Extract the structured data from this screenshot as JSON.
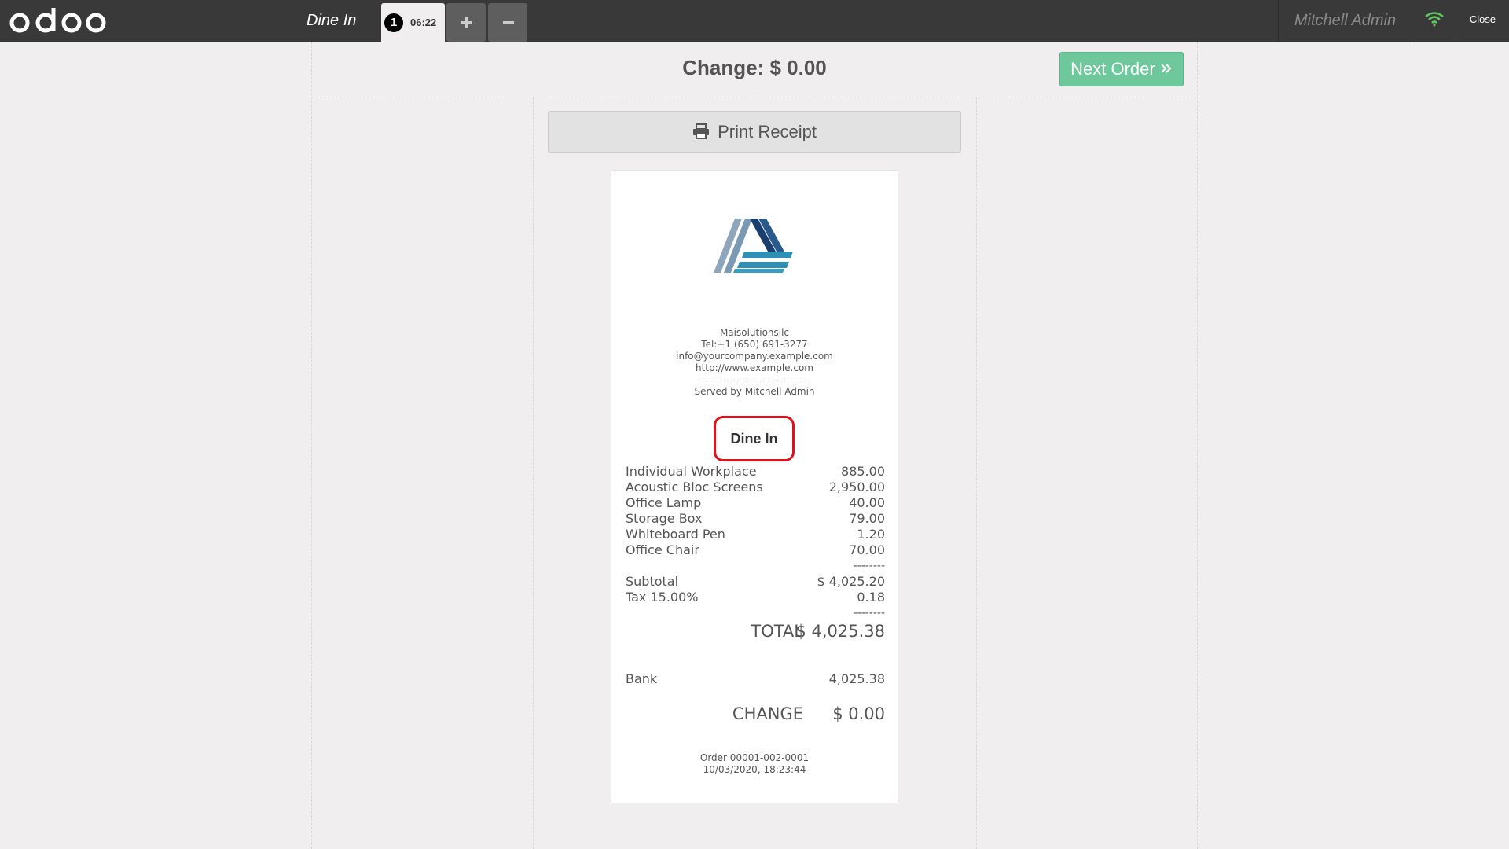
{
  "topbar": {
    "logo_text": "odoo",
    "order_type_label": "Dine In",
    "order_tab": {
      "sequence": "1",
      "time": "06:22"
    },
    "add_order_icon": "plus-icon",
    "remove_order_icon": "minus-icon",
    "user_name": "Mitchell Admin",
    "connection_icon": "wifi-icon",
    "connection_color": "#5ec95e",
    "close_label": "Close"
  },
  "screen": {
    "change_title": "Change: $ 0.00",
    "next_order_label": "Next Order",
    "next_order_icon": "double-chevron-right-icon",
    "next_order_color": "#6ec89b",
    "print_receipt_label": "Print Receipt",
    "print_icon": "printer-icon"
  },
  "receipt": {
    "company_logo": "company-logo",
    "company_name": "Maisolutionsllc",
    "phone": "Tel:+1 (650) 691-3277",
    "email": "info@yourcompany.example.com",
    "website": "http://www.example.com",
    "header_separator": "--------------------------------",
    "served_by": "Served by Mitchell Admin",
    "order_type": "Dine In",
    "lines": [
      {
        "name": "Individual Workplace",
        "price": "885.00"
      },
      {
        "name": "Acoustic Bloc Screens",
        "price": "2,950.00"
      },
      {
        "name": "Office Lamp",
        "price": "40.00"
      },
      {
        "name": "Storage Box",
        "price": "79.00"
      },
      {
        "name": "Whiteboard Pen",
        "price": "1.20"
      },
      {
        "name": "Office Chair",
        "price": "70.00"
      }
    ],
    "dash_separator": "--------",
    "subtotal_label": "Subtotal",
    "subtotal_value": "$ 4,025.20",
    "tax_label": "Tax 15.00%",
    "tax_value": "0.18",
    "total_label": "TOTAL",
    "total_value": "$ 4,025.38",
    "payment_method": "Bank",
    "payment_amount": "4,025.38",
    "change_label": "CHANGE",
    "change_value": "$ 0.00",
    "order_ref": "Order 00001-002-0001",
    "order_datetime": "10/03/2020, 18:23:44"
  }
}
